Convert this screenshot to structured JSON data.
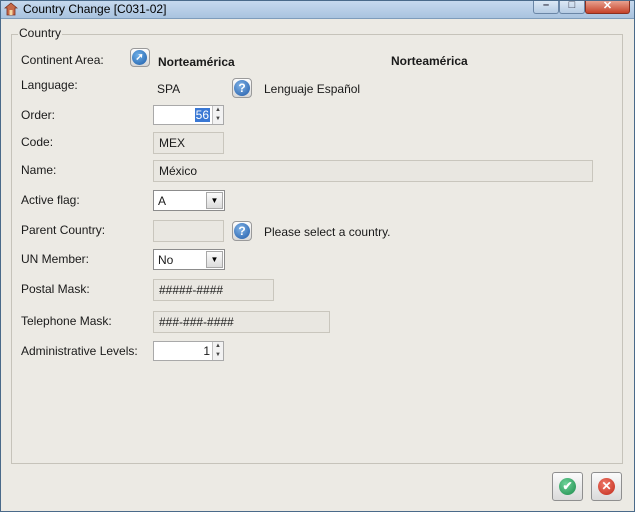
{
  "window": {
    "title": "Country Change [C031-02]"
  },
  "group": {
    "label": "Country"
  },
  "form": {
    "continent_label": "Continent Area:",
    "continent_code": "Norteamérica",
    "continent_name": "Norteamérica",
    "language_label": "Language:",
    "language_code": "SPA",
    "language_name": "Lenguaje Español",
    "order_label": "Order:",
    "order_value": "56",
    "code_label": "Code:",
    "code_value": "MEX",
    "name_label": "Name:",
    "name_value": "México",
    "active_label": "Active flag:",
    "active_value": "A",
    "parent_label": "Parent Country:",
    "parent_value": "",
    "parent_hint": "Please select a country.",
    "un_label": "UN Member:",
    "un_value": "No",
    "postal_label": "Postal Mask:",
    "postal_value": "#####-####",
    "phone_label": "Telephone Mask:",
    "phone_value": "###-###-####",
    "admin_label": "Administrative Levels:",
    "admin_value": "1"
  },
  "icons": {
    "app": "app-window-icon",
    "navigate": "navigate-arrow-icon",
    "help": "question-mark-icon",
    "ok": "checkmark-icon",
    "cancel": "x-cancel-icon"
  },
  "colors": {
    "accent": "#1f5aa8",
    "ok": "#1b8a4b",
    "cancel": "#c0281a"
  }
}
